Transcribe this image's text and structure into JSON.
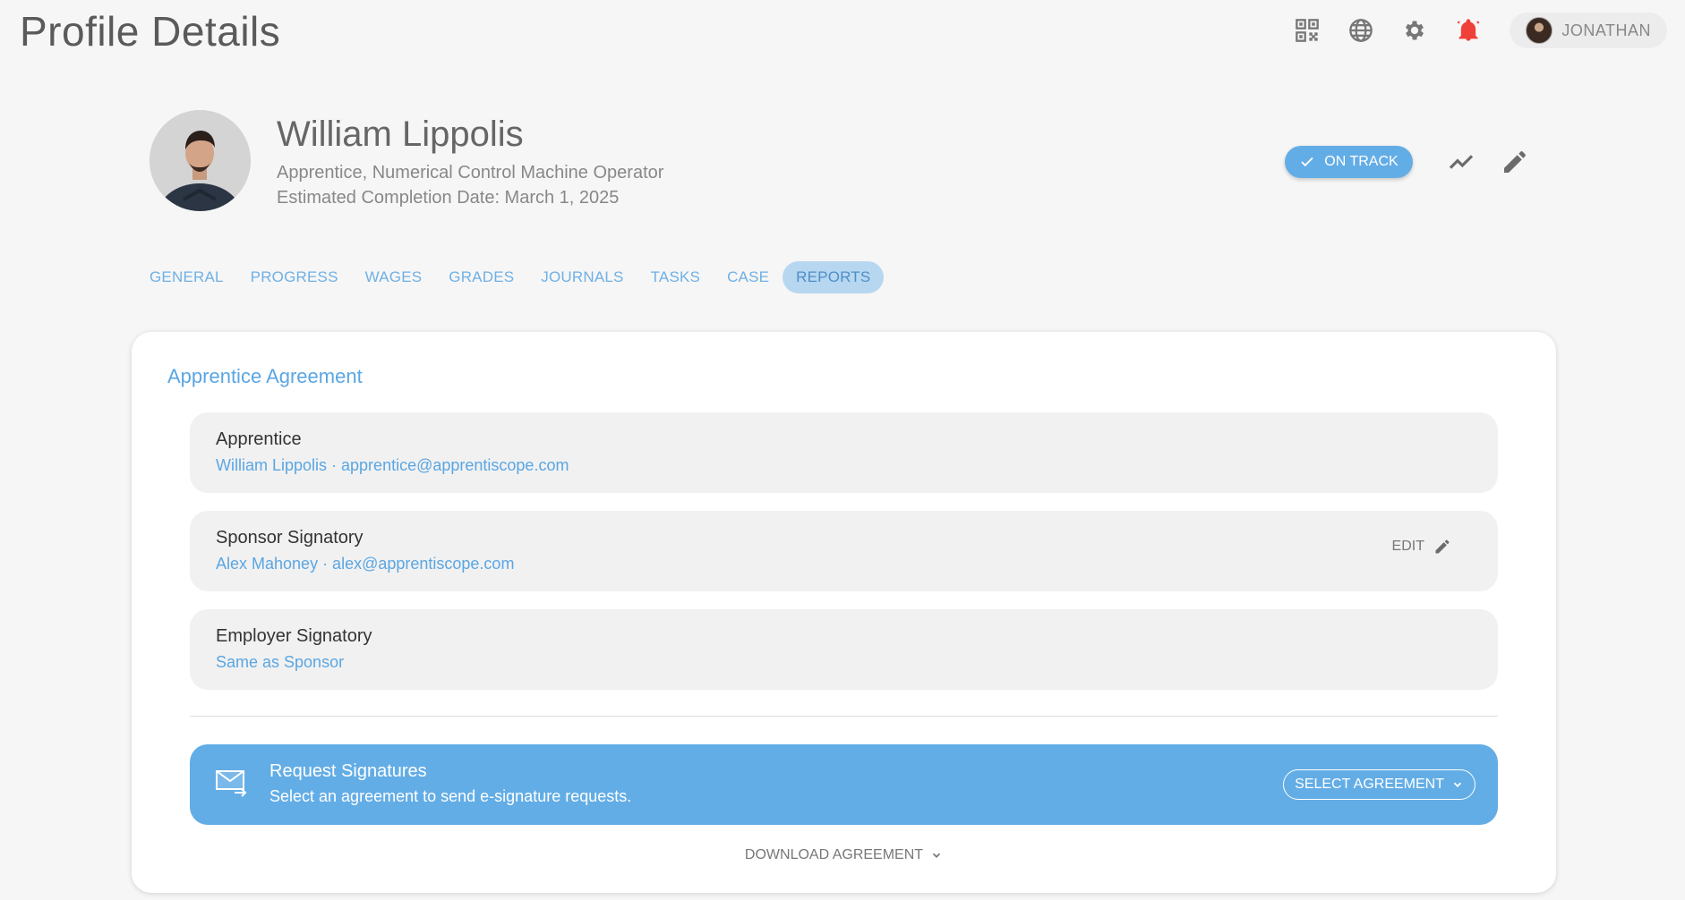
{
  "header": {
    "title": "Profile Details",
    "user_name": "JONATHAN",
    "icons": [
      "qr-code-icon",
      "globe-icon",
      "gear-icon",
      "bell-icon"
    ],
    "bell_color": "#f0403a"
  },
  "profile": {
    "name": "William Lippolis",
    "role": "Apprentice, Numerical Control Machine Operator",
    "completion": "Estimated Completion Date: March 1, 2025",
    "status": "ON TRACK"
  },
  "tabs": [
    {
      "label": "GENERAL"
    },
    {
      "label": "PROGRESS"
    },
    {
      "label": "WAGES"
    },
    {
      "label": "GRADES"
    },
    {
      "label": "JOURNALS"
    },
    {
      "label": "TASKS"
    },
    {
      "label": "CASE"
    },
    {
      "label": "REPORTS",
      "active": true
    }
  ],
  "agreement": {
    "title": "Apprentice Agreement",
    "rows": [
      {
        "title": "Apprentice",
        "subtitle": "William Lippolis · apprentice@apprentiscope.com"
      },
      {
        "title": "Sponsor Signatory",
        "subtitle": "Alex Mahoney · alex@apprentiscope.com",
        "edit_label": "EDIT"
      },
      {
        "title": "Employer Signatory",
        "subtitle": "Same as Sponsor"
      }
    ],
    "request": {
      "title": "Request Signatures",
      "subtitle": "Select an agreement to send e-signature requests.",
      "button": "SELECT AGREEMENT"
    },
    "download_label": "DOWNLOAD AGREEMENT"
  },
  "colors": {
    "accent": "#63ade6",
    "link": "#5aa6e3",
    "tab_active_bg": "#b7d7f1"
  }
}
